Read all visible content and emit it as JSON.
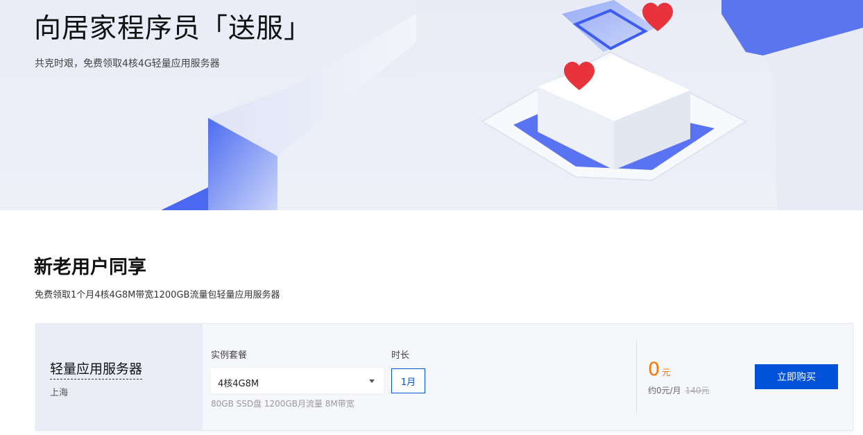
{
  "banner": {
    "title": "向居家程序员「送服」",
    "subtitle": "共克时艰，免费领取4核4G轻量应用服务器"
  },
  "section": {
    "title": "新老用户同享",
    "description": "免费领取1个月4核4G8M带宽1200GB流量包轻量应用服务器"
  },
  "product": {
    "name": "轻量应用服务器",
    "region": "上海",
    "plan_label": "实例套餐",
    "plan_selected": "4核4G8M",
    "plan_spec": "80GB SSD盘 1200GB月流量 8M带宽",
    "duration_label": "时长",
    "duration_value": "1月",
    "price": "0",
    "price_unit": "元",
    "price_monthly": "约0元/月",
    "original_price": "140元",
    "buy_label": "立即购买"
  },
  "colors": {
    "accent": "#0052d9",
    "price": "#ff7200"
  }
}
